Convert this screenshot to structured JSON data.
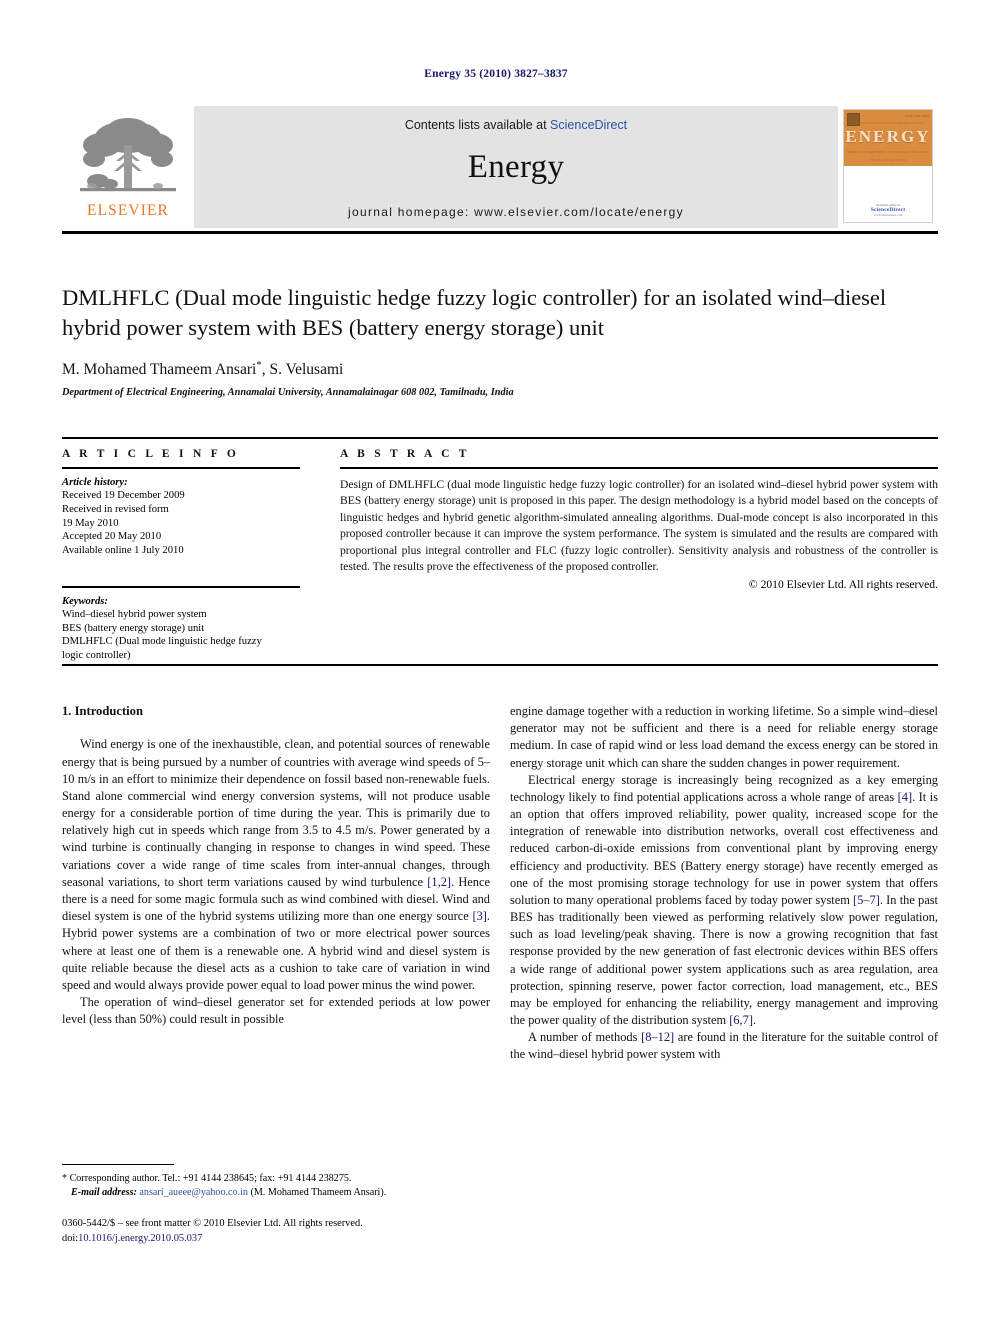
{
  "running_head": "Energy 35 (2010) 3827–3837",
  "masthead": {
    "publisher_name": "ELSEVIER",
    "contents_prefix": "Contents lists available at ",
    "contents_link": "ScienceDirect",
    "journal_title": "Energy",
    "homepage": "journal homepage: www.elsevier.com/locate/energy",
    "cover": {
      "title": "ENERGY",
      "code": "ISSN 0360-5442",
      "row_top": "TECHNOLOGY        SCIENCE        PLANNING        POLICY",
      "row_bottom": "ENERGY        ENVIRONMENT        ECONOMICS        EDUCATION",
      "subtitle": "The International Journal",
      "available_at": "Available online at",
      "sd_label": "ScienceDirect",
      "sd_url": "www.sciencedirect.com"
    }
  },
  "article": {
    "title": "DMLHFLC (Dual mode linguistic hedge fuzzy logic controller) for an isolated wind–diesel hybrid power system with BES (battery energy storage) unit",
    "authors": "M. Mohamed Thameem Ansari, S. Velusami",
    "author_marker": "*",
    "affiliation": "Department of Electrical Engineering, Annamalai University, Annamalainagar 608 002, Tamilnadu, India"
  },
  "article_info": {
    "heading": "A R T I C L E   I N F O",
    "history_heading": "Article history:",
    "history_lines": [
      "Received 19 December 2009",
      "Received in revised form",
      "19 May 2010",
      "Accepted 20 May 2010",
      "Available online 1 July 2010"
    ],
    "keywords_heading": "Keywords:",
    "keywords": [
      "Wind–diesel hybrid power system",
      "BES (battery energy storage) unit",
      "DMLHFLC (Dual mode linguistic hedge fuzzy",
      "logic controller)"
    ]
  },
  "abstract": {
    "heading": "A B S T R A C T",
    "text": "Design of DMLHFLC (dual mode linguistic hedge fuzzy logic controller) for an isolated wind–diesel hybrid power system with BES (battery energy storage) unit is proposed in this paper. The design methodology is a hybrid model based on the concepts of linguistic hedges and hybrid genetic algorithm-simulated annealing algorithms. Dual-mode concept is also incorporated in this proposed controller because it can improve the system performance. The system is simulated and the results are compared with proportional plus integral controller and FLC (fuzzy logic controller). Sensitivity analysis and robustness of the controller is tested. The results prove the effectiveness of the proposed controller.",
    "copyright": "© 2010 Elsevier Ltd. All rights reserved."
  },
  "body": {
    "section_heading": "1.  Introduction",
    "left_paragraphs": [
      "Wind energy is one of the inexhaustible, clean, and potential sources of renewable energy that is being pursued by a number of countries with average wind speeds of 5–10 m/s in an effort to minimize their dependence on fossil based non-renewable fuels. Stand alone commercial wind energy conversion systems, will not produce usable energy for a considerable portion of time during the year. This is primarily due to relatively high cut in speeds which range from 3.5 to 4.5 m/s. Power generated by a wind turbine is continually changing in response to changes in wind speed. These variations cover a wide range of time scales from inter-annual changes, through seasonal variations, to short term variations caused by wind turbulence [1,2]. Hence there is a need for some magic formula such as wind combined with diesel. Wind and diesel system is one of the hybrid systems utilizing more than one energy source [3]. Hybrid power systems are a combination of two or more electrical power sources where at least one of them is a renewable one. A hybrid wind and diesel system is quite reliable because the diesel acts as a cushion to take care of variation in wind speed and would always provide power equal to load power minus the wind power.",
      "The operation of wind–diesel generator set for extended periods at low power level (less than 50%) could result in possible"
    ],
    "right_paragraphs": [
      "engine damage together with a reduction in working lifetime. So a simple wind–diesel generator may not be sufficient and there is a need for reliable energy storage medium. In case of rapid wind or less load demand the excess energy can be stored in energy storage unit which can share the sudden changes in power requirement.",
      "Electrical energy storage is increasingly being recognized as a key emerging technology likely to find potential applications across a whole range of areas [4]. It is an option that offers improved reliability, power quality, increased scope for the integration of renewable into distribution networks, overall cost effectiveness and reduced carbon-di-oxide emissions from conventional plant by improving energy efficiency and productivity. BES (Battery energy storage) have recently emerged as one of the most promising storage technology for use in power system that offers solution to many operational problems faced by today power system [5–7]. In the past BES has traditionally been viewed as performing relatively slow power regulation, such as load leveling/peak shaving. There is now a growing recognition that fast response provided by the new generation of fast electronic devices within BES offers a wide range of additional power system applications such as area regulation, area protection, spinning reserve, power factor correction, load management, etc., BES may be employed for enhancing the reliability, energy management and improving the power quality of the distribution system [6,7].",
      "A number of methods [8–12] are found in the literature for the suitable control of the wind–diesel hybrid power system with"
    ]
  },
  "footnote": {
    "marker": "*",
    "corresponding": "Corresponding author. Tel.: +91 4144 238645; fax: +91 4144 238275.",
    "email_label": "E-mail address:",
    "email": "ansari_aueee@yahoo.co.in",
    "email_owner": "(M. Mohamed Thameem Ansari)."
  },
  "page_footer": {
    "front_matter": "0360-5442/$ – see front matter © 2010 Elsevier Ltd. All rights reserved.",
    "doi_label": "doi:",
    "doi": "10.1016/j.energy.2010.05.037"
  },
  "colors": {
    "link_blue": "#2b52a5",
    "cite_navy": "#16166b",
    "elsevier_orange": "#e87722",
    "masthead_gray": "#e3e3e3"
  }
}
